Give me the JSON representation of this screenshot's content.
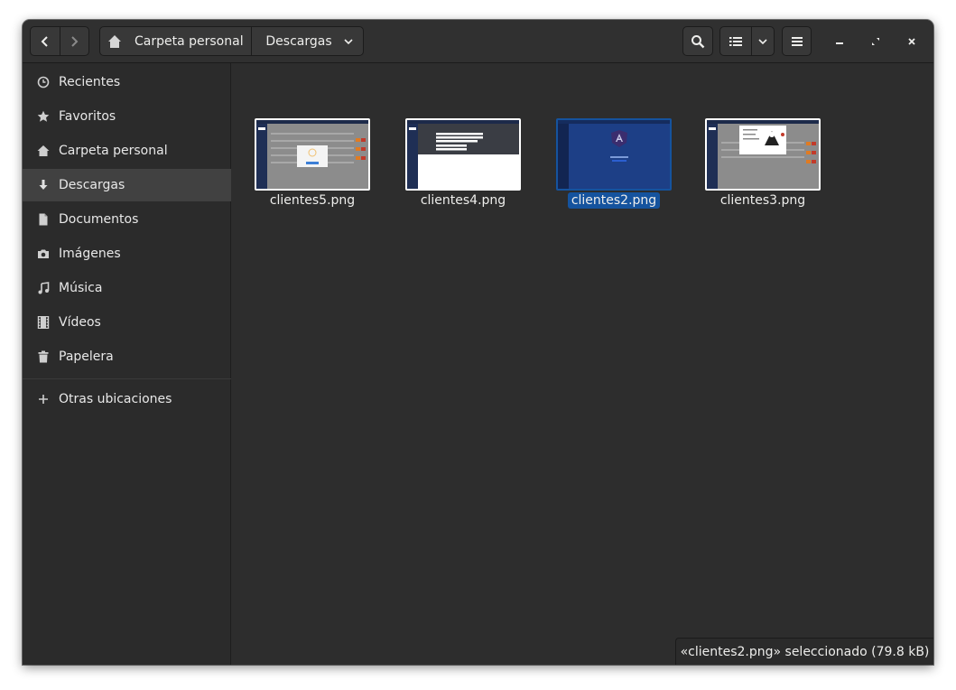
{
  "header": {
    "back_icon": "chevron-left-icon",
    "forward_icon": "chevron-right-icon",
    "path": [
      "Carpeta personal",
      "Descargas"
    ],
    "path_home_icon": "home-icon",
    "search_icon": "search-icon",
    "view_icon": "list-view-icon",
    "view_dropdown_icon": "chevron-down-icon",
    "menu_icon": "hamburger-icon",
    "minimize_icon": "minimize-icon",
    "maximize_icon": "maximize-icon",
    "close_icon": "close-icon"
  },
  "sidebar": {
    "items": [
      {
        "label": "Recientes",
        "icon": "clock-icon"
      },
      {
        "label": "Favoritos",
        "icon": "star-icon"
      },
      {
        "label": "Carpeta personal",
        "icon": "home-icon"
      },
      {
        "label": "Descargas",
        "icon": "download-icon",
        "active": true
      },
      {
        "label": "Documentos",
        "icon": "document-icon"
      },
      {
        "label": "Imágenes",
        "icon": "camera-icon"
      },
      {
        "label": "Música",
        "icon": "music-icon"
      },
      {
        "label": "Vídeos",
        "icon": "film-icon"
      },
      {
        "label": "Papelera",
        "icon": "trash-icon"
      }
    ],
    "other_locations": {
      "label": "Otras ubicaciones",
      "icon": "plus-icon"
    }
  },
  "files": [
    {
      "name": "clientes5.png",
      "selected": false
    },
    {
      "name": "clientes4.png",
      "selected": false
    },
    {
      "name": "clientes2.png",
      "selected": true
    },
    {
      "name": "clientes3.png",
      "selected": false
    }
  ],
  "status": {
    "text": "«clientes2.png» seleccionado  (79.8 kB)"
  },
  "colors": {
    "selection": "#15539e",
    "window_bg": "#2d2d2d",
    "sidebar_active": "#414141"
  }
}
